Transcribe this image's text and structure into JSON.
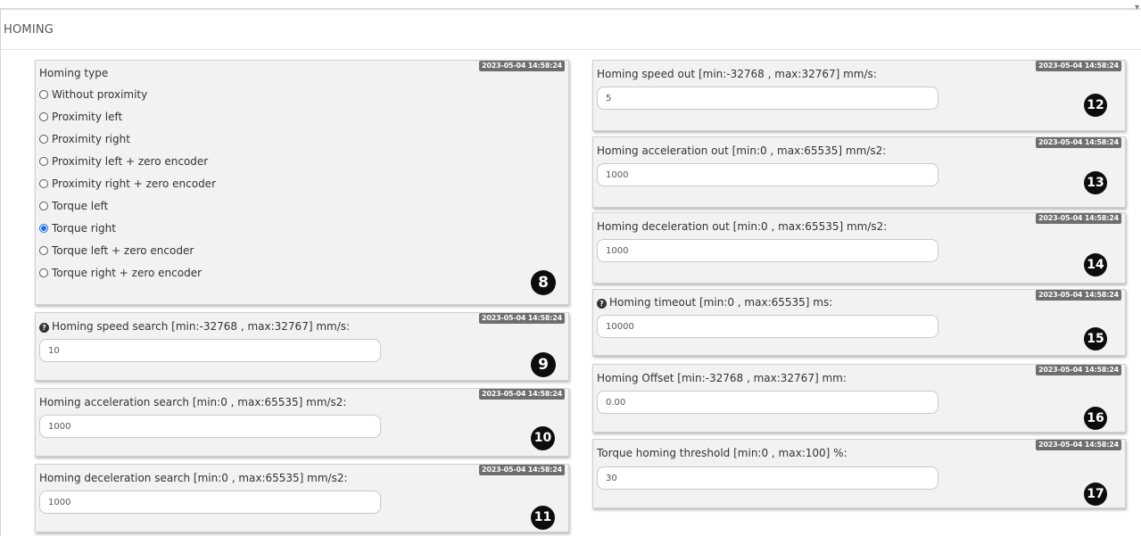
{
  "header": {
    "title": "HOMING",
    "corner_mark": "▾"
  },
  "homing_type": {
    "label": "Homing type",
    "timestamp": "2023-05-04 14:58:24",
    "badge": "8",
    "options": [
      {
        "label": "Without proximity",
        "selected": false
      },
      {
        "label": "Proximity left",
        "selected": false
      },
      {
        "label": "Proximity right",
        "selected": false
      },
      {
        "label": "Proximity left + zero encoder",
        "selected": false
      },
      {
        "label": "Proximity right + zero encoder",
        "selected": false
      },
      {
        "label": "Torque left",
        "selected": false
      },
      {
        "label": "Torque right",
        "selected": true
      },
      {
        "label": "Torque left + zero encoder",
        "selected": false
      },
      {
        "label": "Torque right + zero encoder",
        "selected": false
      }
    ]
  },
  "fields": {
    "speed_search": {
      "label": "Homing speed search [min:-32768 , max:32767] mm/s:",
      "value": "10",
      "timestamp": "2023-05-04 14:58:24",
      "badge": "9",
      "help": "?"
    },
    "accel_search": {
      "label": "Homing acceleration search [min:0 , max:65535] mm/s2:",
      "value": "1000",
      "timestamp": "2023-05-04 14:58:24",
      "badge": "10"
    },
    "decel_search": {
      "label": "Homing deceleration search [min:0 , max:65535] mm/s2:",
      "value": "1000",
      "timestamp": "2023-05-04 14:58:24",
      "badge": "11"
    },
    "speed_out": {
      "label": "Homing speed out [min:-32768 , max:32767] mm/s:",
      "value": "5",
      "timestamp": "2023-05-04 14:58:24",
      "badge": "12"
    },
    "accel_out": {
      "label": "Homing acceleration out [min:0 , max:65535] mm/s2:",
      "value": "1000",
      "timestamp": "2023-05-04 14:58:24",
      "badge": "13"
    },
    "decel_out": {
      "label": "Homing deceleration out [min:0 , max:65535] mm/s2:",
      "value": "1000",
      "timestamp": "2023-05-04 14:58:24",
      "badge": "14"
    },
    "timeout": {
      "label": "Homing timeout [min:0 , max:65535] ms:",
      "value": "10000",
      "timestamp": "2023-05-04 14:58:24",
      "badge": "15",
      "help": "?"
    },
    "offset": {
      "label": "Homing Offset [min:-32768 , max:32767] mm:",
      "value": "0.00",
      "timestamp": "2023-05-04 14:58:24",
      "badge": "16"
    },
    "torque_threshold": {
      "label": "Torque homing threshold [min:0 , max:100] %:",
      "value": "30",
      "timestamp": "2023-05-04 14:58:24",
      "badge": "17"
    }
  }
}
